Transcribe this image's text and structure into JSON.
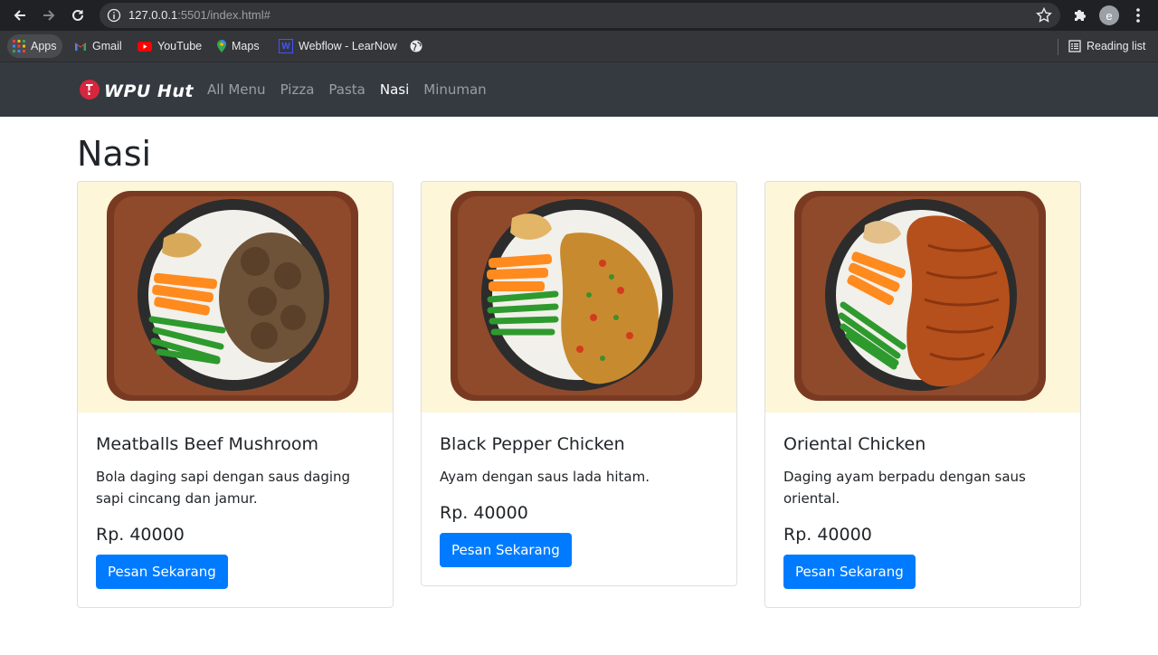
{
  "browser": {
    "url_host": "127.0.0.1",
    "url_rest": ":5501/index.html#",
    "avatar_letter": "e",
    "bookmarks": [
      {
        "label": "Apps",
        "icon": "apps-grid-icon"
      },
      {
        "label": "Gmail",
        "icon": "gmail-icon"
      },
      {
        "label": "YouTube",
        "icon": "youtube-icon"
      },
      {
        "label": "Maps",
        "icon": "maps-icon"
      },
      {
        "label": "Webflow - LearNow",
        "icon": "webflow-icon"
      }
    ],
    "reading_list": "Reading list"
  },
  "site": {
    "brand": "WPU Hut",
    "nav": [
      {
        "label": "All Menu",
        "active": false
      },
      {
        "label": "Pizza",
        "active": false
      },
      {
        "label": "Pasta",
        "active": false
      },
      {
        "label": "Nasi",
        "active": true
      },
      {
        "label": "Minuman",
        "active": false
      }
    ],
    "colors": {
      "navbar": "#343a40",
      "primary": "#007bff"
    }
  },
  "main": {
    "title": "Nasi",
    "cards": [
      {
        "title": "Meatballs Beef Mushroom",
        "description": "Bola daging sapi dengan saus daging sapi cincang dan jamur.",
        "price": "Rp. 40000",
        "button": "Pesan Sekarang",
        "image": "meatballs-rice-bowl"
      },
      {
        "title": "Black Pepper Chicken",
        "description": "Ayam dengan saus lada hitam.",
        "price": "Rp. 40000",
        "button": "Pesan Sekarang",
        "image": "black-pepper-chicken-rice-bowl"
      },
      {
        "title": "Oriental Chicken",
        "description": "Daging ayam berpadu dengan saus oriental.",
        "price": "Rp. 40000",
        "button": "Pesan Sekarang",
        "image": "oriental-chicken-rice-bowl"
      }
    ]
  }
}
